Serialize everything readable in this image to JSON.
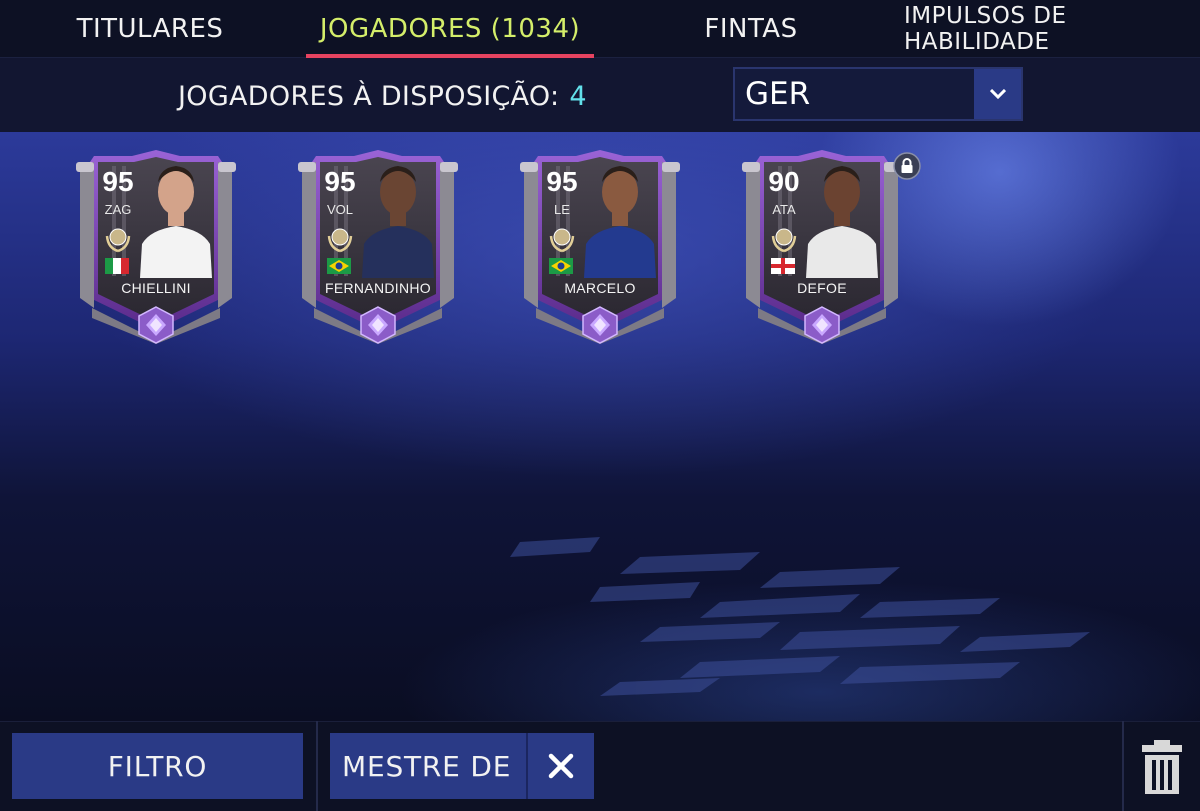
{
  "tabs": [
    {
      "label": "TITULARES",
      "active": false
    },
    {
      "label": "JOGADORES (1034)",
      "active": true
    },
    {
      "label": "FINTAS",
      "active": false
    },
    {
      "label": "IMPULSOS DE HABILIDADE",
      "active": false
    }
  ],
  "subheader": {
    "available_label": "JOGADORES À DISPOSIÇÃO:",
    "available_count": "4",
    "position_select": {
      "value": "GER"
    }
  },
  "players": [
    {
      "rating": "95",
      "position": "ZAG",
      "name": "CHIELLINI",
      "nation_flag": "italy",
      "locked": false
    },
    {
      "rating": "95",
      "position": "VOL",
      "name": "FERNANDINHO",
      "nation_flag": "brazil",
      "locked": false
    },
    {
      "rating": "95",
      "position": "LE",
      "name": "MARCELO",
      "nation_flag": "brazil",
      "locked": false
    },
    {
      "rating": "90",
      "position": "ATA",
      "name": "DEFOE",
      "nation_flag": "england",
      "locked": true
    }
  ],
  "bottom": {
    "filter_label": "FILTRO",
    "active_filter_label": "MESTRE DE",
    "clear_icon": "close-icon",
    "trash_icon": "trash-icon"
  },
  "colors": {
    "active_tab": "#d4ee6a",
    "tab_underline": "#e64360",
    "count": "#62e0ea",
    "button_bg": "#2a3a86",
    "card_purple": "#7a3fb0"
  }
}
